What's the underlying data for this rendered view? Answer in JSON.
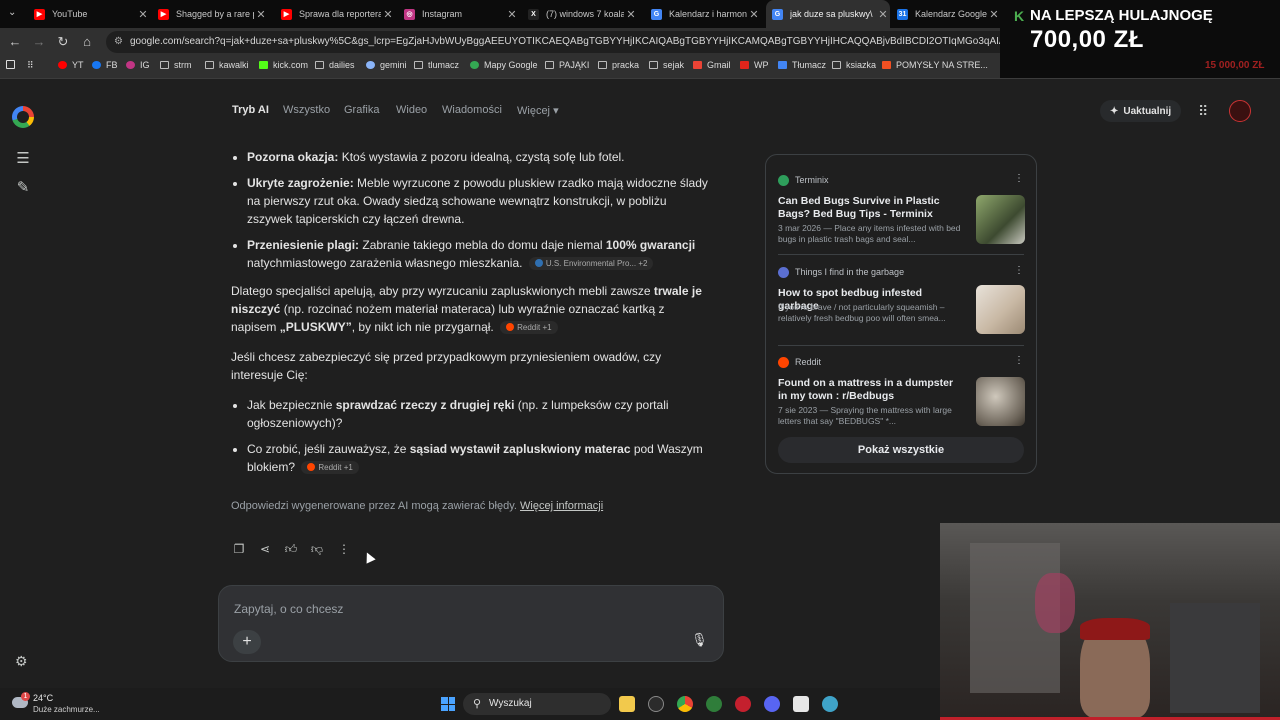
{
  "browser": {
    "tabs": [
      {
        "title": "YouTube",
        "color": "#ff0000"
      },
      {
        "title": "Shagged by a rare pa",
        "color": "#ff0000"
      },
      {
        "title": "Sprawa dla reportera",
        "color": "#ff0000"
      },
      {
        "title": "Instagram",
        "color": "#c13584"
      },
      {
        "title": "(7) windows 7 koala w",
        "color": "#000000"
      },
      {
        "title": "Kalendarz i harmonogr",
        "color": "#4285f4"
      },
      {
        "title": "jak duze sa pluskwy\\",
        "color": "#4285f4",
        "active": true
      },
      {
        "title": "Kalendarz Google - sp",
        "color": "#1a73e8"
      }
    ],
    "url": "google.com/search?q=jak+duze+sa+pluskwy%5C&gs_lcrp=EgZjaHJvbWUyBggAEEUYOTIKCAEQABgTGBYYHjIKCAIQABgTGBYYHjIKCAMQABgTGBYYHjIHCAQQABjvBdIBCDI2OTIqMGo3qAIAsAIA&sourceid=chrome&ie=UTF-8",
    "bookmarks": [
      {
        "label": "YT",
        "icon": "youtube-icon",
        "color": "#ff0000"
      },
      {
        "label": "FB",
        "icon": "facebook-icon",
        "color": "#1877f2"
      },
      {
        "label": "IG",
        "icon": "instagram-icon",
        "color": "#c13584"
      },
      {
        "label": "strm",
        "icon": "folder-icon"
      },
      {
        "label": "kawalki",
        "icon": "folder-icon"
      },
      {
        "label": "kick.com",
        "icon": "kick-icon",
        "color": "#53fc18"
      },
      {
        "label": "dailies",
        "icon": "folder-icon"
      },
      {
        "label": "gemini",
        "icon": "gemini-icon",
        "color": "#8ab4f8"
      },
      {
        "label": "tlumacz",
        "icon": "folder-icon"
      },
      {
        "label": "Mapy Google",
        "icon": "maps-icon",
        "color": "#34a853"
      },
      {
        "label": "PAJĄKI",
        "icon": "folder-icon"
      },
      {
        "label": "pracka",
        "icon": "folder-icon"
      },
      {
        "label": "sejak",
        "icon": "folder-icon"
      },
      {
        "label": "Gmail",
        "icon": "gmail-icon",
        "color": "#ea4335"
      },
      {
        "label": "WP",
        "icon": "wp-icon",
        "color": "#e1251b"
      },
      {
        "label": "Tłumacz",
        "icon": "translate-icon",
        "color": "#4285f4"
      },
      {
        "label": "ksiazka",
        "icon": "folder-icon"
      },
      {
        "label": "POMYSŁY NA STRE...",
        "icon": "microsoft-icon",
        "color": "#f25022"
      }
    ],
    "bookmarks_display": [
      "YT",
      "FB",
      "IG",
      "strm",
      "kawalki",
      "kick.com",
      "dailies",
      "gemini",
      "tlumacz",
      "Mapy Google",
      "PAJĄKI",
      "pracka",
      "sejak",
      "Gmail",
      "WP",
      "Tłumacz",
      "ksiazka",
      "POMYSŁY NA STRE..."
    ],
    "bookmarks_more": "AD"
  },
  "promo": {
    "line1": "NA LEPSZĄ HULAJNOGĘ",
    "line2": "700,00 ZŁ",
    "line3": "15 000,00 ZŁ"
  },
  "search": {
    "tabs": [
      "Tryb AI",
      "Wszystko",
      "Grafika",
      "Wideo",
      "Wiadomości",
      "Więcej"
    ],
    "upgrade_label": "Uaktualnij"
  },
  "answer": {
    "b1_bold": "Pozorna okazja:",
    "b1_text": " Ktoś wystawia z pozoru idealną, czystą sofę lub fotel.",
    "b2_bold": "Ukryte zagrożenie:",
    "b2_text": " Meble wyrzucone z powodu pluskiew rzadko mają widoczne ślady na pierwszy rzut oka. Owady siedzą schowane wewnątrz konstrukcji, w pobliżu zszywek tapicerskich czy łączeń drewna.",
    "b3_bold": "Przeniesienie plagi:",
    "b3_text1": " Zabranie takiego mebla do domu daje niemal ",
    "b3_bold2": "100% gwarancji",
    "b3_text2": " natychmiastowego zarażenia własnego mieszkania.",
    "b3_chip": "U.S. Environmental Pro...",
    "b3_chip_count": "+2",
    "p1_text1": "Dlatego specjaliści apelują, aby przy wyrzucaniu zapluskwionych mebli zawsze ",
    "p1_bold": "trwale je niszczyć",
    "p1_text2": " (np. rozcinać nożem materiał materaca) lub wyraźnie oznaczać kartką z napisem ",
    "p1_bold2": "„PLUSKWY”",
    "p1_text3": ", by nikt ich nie przygarnął.",
    "p1_chip": "Reddit",
    "p1_chip_count": "+1",
    "p2_text": "Jeśli chcesz zabezpieczyć się przed przypadkowym przyniesieniem owadów, czy interesuje Cię:",
    "q1_text1": "Jak bezpiecznie ",
    "q1_bold": "sprawdzać rzeczy z drugiej ręki",
    "q1_text2": " (np. z lumpeksów czy portali ogłoszeniowych)?",
    "q2_text1": "Co zrobić, jeśli zauważysz, że ",
    "q2_bold": "sąsiad wystawił zapluskwiony materac",
    "q2_text2": " pod Waszym blokiem?",
    "q2_chip": "Reddit",
    "q2_chip_count": "+1",
    "disclaimer": "Odpowiedzi wygenerowane przez AI mogą zawierać błędy.",
    "disclaimer_link": "Więcej informacji"
  },
  "sources": {
    "items": [
      {
        "site": "Terminix",
        "title": "Can Bed Bugs Survive in Plastic Bags? Bed Bug Tips - Terminix",
        "snippet": "3 mar 2026 — Place any items infested with bed bugs in plastic trash bags and seal...",
        "fav_color": "#2e9e5b"
      },
      {
        "site": "Things I find in the garbage",
        "title": "How to spot bedbug infested garbage",
        "snippet": "If you're brave / not particularly squeamish – relatively fresh bedbug poo will often smea...",
        "fav_color": "#5b6fd1"
      },
      {
        "site": "Reddit",
        "title": "Found on a mattress in a dumpster in my town : r/Bedbugs",
        "snippet": "7 sie 2023 — Spraying the mattress with large letters that say \"BEDBUGS\" *...",
        "fav_color": "#ff4500"
      }
    ],
    "show_all": "Pokaż wszystkie"
  },
  "input": {
    "placeholder": "Zapytaj, o co chcesz"
  },
  "taskbar": {
    "temperature": "24°C",
    "weather": "Duże zachmurze...",
    "weather_badge": "1",
    "search_label": "Wyszukaj"
  }
}
